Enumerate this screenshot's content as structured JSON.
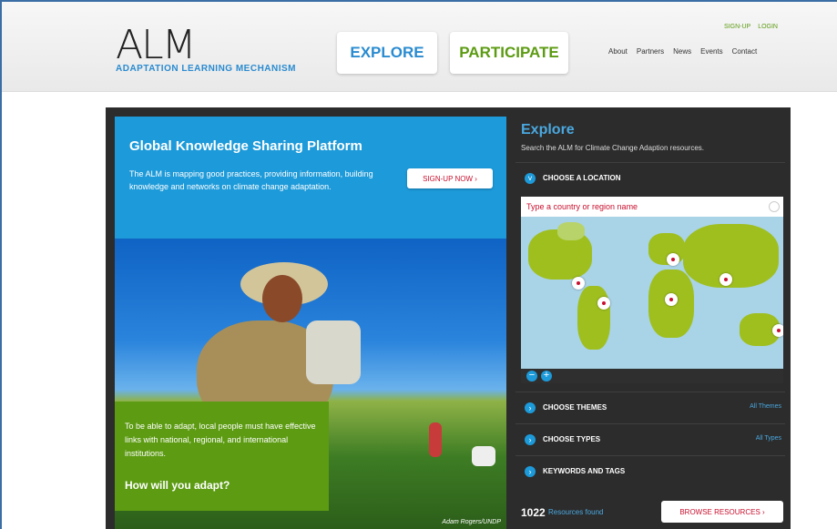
{
  "header": {
    "logo_mark": "ALM",
    "logo_subtitle": "ADAPTATION LEARNING MECHANISM",
    "nav": {
      "explore": "EXPLORE",
      "participate": "PARTICIPATE"
    },
    "top_links": {
      "signup": "SIGN-UP",
      "login": "LOGIN"
    },
    "main_links": [
      "About",
      "Partners",
      "News",
      "Events",
      "Contact"
    ]
  },
  "hero": {
    "title": "Global Knowledge Sharing Platform",
    "description": "The ALM is mapping good practices, providing information, building knowledge and networks on climate change adaptation.",
    "signup_button": "SIGN-UP NOW  ›",
    "photo_credit": "Adam Rogers/UNDP",
    "callout_text": "To be able to adapt, local people must have effective links with national, regional, and international institutions.",
    "callout_question": "How will you adapt?"
  },
  "explore": {
    "title": "Explore",
    "subtitle": "Search the ALM for Climate Change Adaption resources.",
    "location_label": "CHOOSE A LOCATION",
    "map_placeholder": "Type a country or region name",
    "themes_label": "CHOOSE THEMES",
    "themes_link": "All Themes",
    "types_label": "CHOOSE TYPES",
    "types_link": "All Types",
    "keywords_label": "KEYWORDS AND TAGS",
    "resource_count": "1022",
    "resource_label": "Resources found",
    "browse_button": "BROWSE RESOURCES  ›"
  },
  "icons": {
    "chevron": "chevron-icon",
    "zoom_in": "+",
    "zoom_out": "−"
  },
  "colors": {
    "brand_blue": "#1d9ad9",
    "brand_green": "#5c9b12",
    "accent_red": "#c8102e",
    "panel_dark": "#2c2c2c"
  }
}
